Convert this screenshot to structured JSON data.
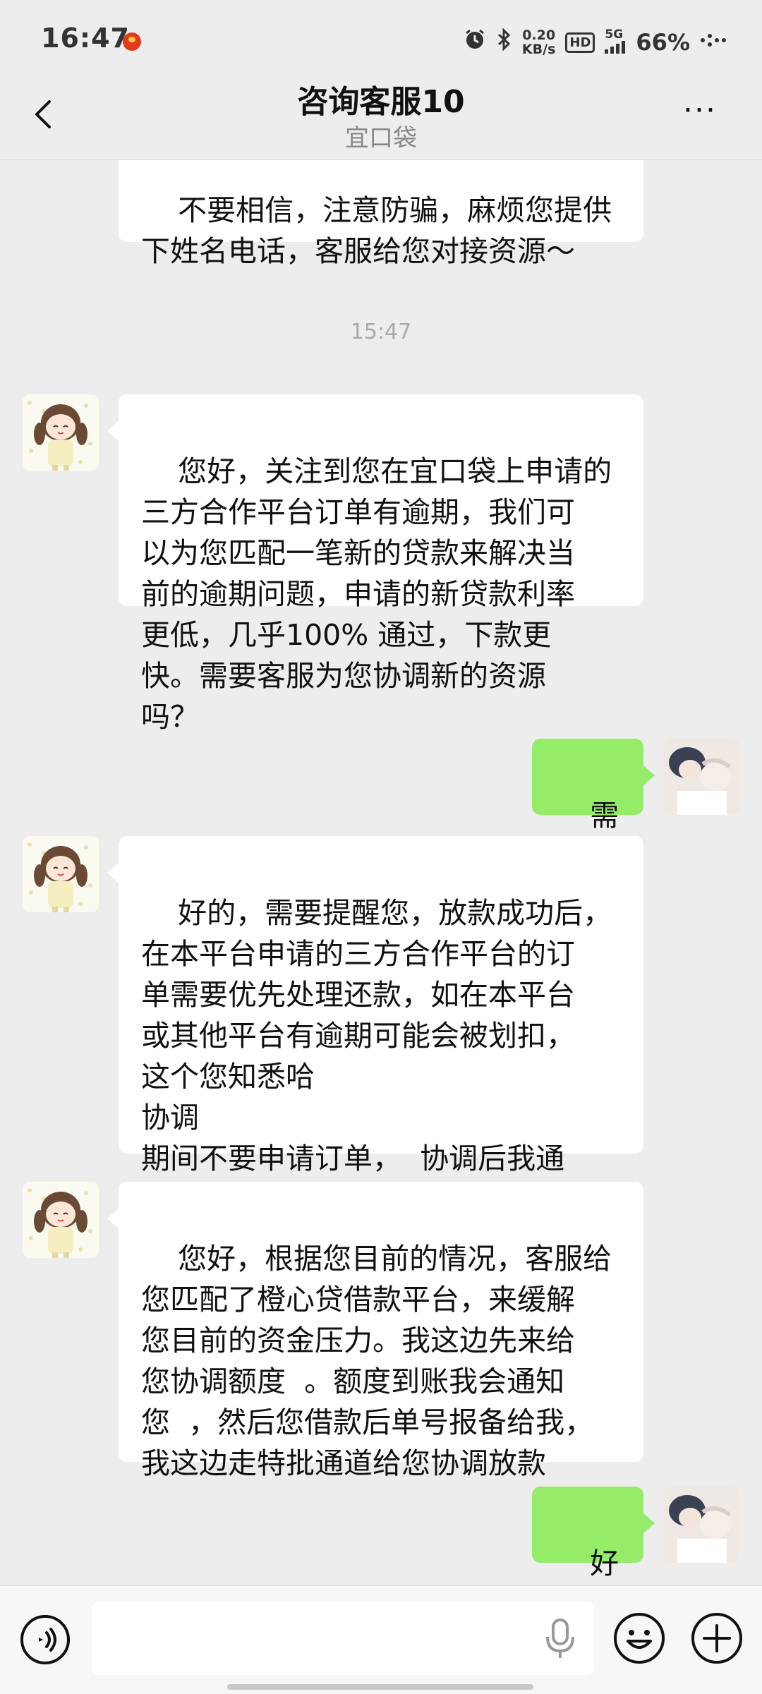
{
  "status_bar": {
    "time": "16:47",
    "speed_value": "0.20",
    "speed_unit": "KB/s",
    "hd": "HD",
    "network": "5G",
    "battery": "66%",
    "icons": [
      "app-notification-icon",
      "alarm-icon",
      "bluetooth-icon",
      "signal-icon",
      "more-dots-icon"
    ]
  },
  "header": {
    "title": "咨询客服10",
    "subtitle": "宜口袋",
    "back_icon": "chevron-left-icon",
    "more_label": "···"
  },
  "messages": [
    {
      "side": "in",
      "text": "不要相信，注意防骗，麻烦您提供\n下姓名电话，客服给您对接资源～"
    },
    {
      "timestamp": "15:47"
    },
    {
      "side": "in",
      "text": "您好，关注到您在宜口袋上申请的\n三方合作平台订单有逾期，我们可\n以为您匹配一笔新的贷款来解决当\n前的逾期问题，申请的新贷款利率\n更低，几乎100% 通过，下款更\n快。需要客服为您协调新的资源\n吗？"
    },
    {
      "side": "out",
      "text": "需要"
    },
    {
      "side": "in",
      "text": "好的，需要提醒您，放款成功后，\n在本平台申请的三方合作平台的订\n单需要优先处理还款，如在本平台\n或其他平台有逾期可能会被划扣，\n这个您知悉哈                                协调\n期间不要申请订单，  协调后我通\n知您  您再申请"
    },
    {
      "side": "in",
      "text": "您好，根据您目前的情况，客服给\n您匹配了橙心贷借款平台，来缓解\n您目前的资金压力。我这边先来给\n您协调额度  。额度到账我会通知\n您  ，然后您借款后单号报备给我，\n我这边走特批通道给您协调放款"
    },
    {
      "side": "out",
      "text": "好的"
    }
  ],
  "input_bar": {
    "placeholder": "",
    "icons": [
      "voice-icon",
      "microphone-icon",
      "emoji-icon",
      "plus-icon"
    ]
  },
  "colors": {
    "background": "#ededed",
    "incoming_bubble": "#ffffff",
    "outgoing_bubble": "#95ec69",
    "timestamp": "#aaaaaa"
  }
}
